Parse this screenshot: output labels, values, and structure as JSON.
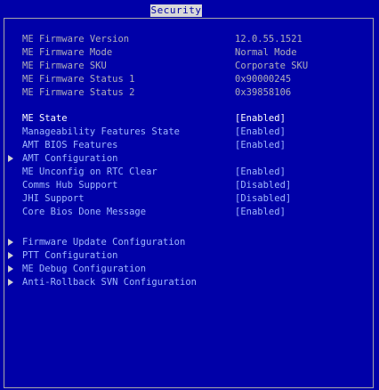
{
  "header": {
    "active_tab": "Security"
  },
  "info": [
    {
      "label": "ME Firmware Version",
      "value": "12.0.55.1521"
    },
    {
      "label": "ME Firmware Mode",
      "value": "Normal Mode"
    },
    {
      "label": "ME Firmware SKU",
      "value": "Corporate SKU"
    },
    {
      "label": "ME Firmware Status 1",
      "value": "0x90000245"
    },
    {
      "label": "ME Firmware Status 2",
      "value": "0x39858106"
    }
  ],
  "settings": [
    {
      "label": "ME State",
      "value": "[Enabled]"
    },
    {
      "label": "Manageability Features State",
      "value": "[Enabled]"
    },
    {
      "label": "AMT BIOS Features",
      "value": "[Enabled]"
    },
    {
      "label": "AMT Configuration",
      "value": ""
    },
    {
      "label": "ME Unconfig on RTC Clear",
      "value": "[Enabled]"
    },
    {
      "label": "Comms Hub Support",
      "value": "[Disabled]"
    },
    {
      "label": "JHI Support",
      "value": "[Disabled]"
    },
    {
      "label": "Core Bios Done Message",
      "value": "[Enabled]"
    }
  ],
  "submenus": [
    {
      "label": "Firmware Update Configuration"
    },
    {
      "label": "PTT Configuration"
    },
    {
      "label": "ME Debug Configuration"
    },
    {
      "label": "Anti-Rollback SVN Configuration"
    }
  ],
  "colors": {
    "background": "#0000a8",
    "tab_background": "#d8d8d8",
    "info_text": "#b0b0b8",
    "option_text": "#a0b8ff",
    "selected_text": "#ffffff"
  }
}
